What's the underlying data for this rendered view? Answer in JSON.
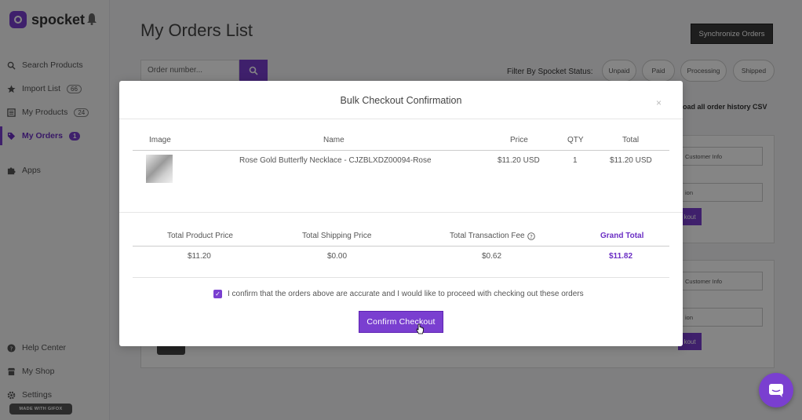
{
  "app": {
    "logo_text": "spocket"
  },
  "sidebar": {
    "items": [
      {
        "label": "Search Products",
        "icon": "search-icon"
      },
      {
        "label": "Import List",
        "badge": "66",
        "icon": "star-icon"
      },
      {
        "label": "My Products",
        "badge": "24",
        "icon": "list-icon"
      },
      {
        "label": "My Orders",
        "badge": "1",
        "icon": "tag-icon",
        "active": true
      },
      {
        "label": "Apps",
        "icon": "puzzle-icon"
      }
    ],
    "bottom_items": [
      {
        "label": "Help Center",
        "icon": "help-icon"
      },
      {
        "label": "My Shop",
        "icon": "shop-icon"
      },
      {
        "label": "Settings",
        "icon": "gear-icon"
      }
    ],
    "watermark": "MADE WITH GIFOX"
  },
  "main": {
    "title": "My Orders List",
    "sync_button": "Synchronize Orders",
    "search_placeholder": "Order number...",
    "filter_label": "Filter By Spocket Status:",
    "filters": [
      "Unpaid",
      "Paid",
      "Processing",
      "Shipped"
    ],
    "download_link": "nload all order history CSV",
    "card_customer_info": "Customer Info",
    "card_option": "ion",
    "card_checkout": "kout"
  },
  "modal": {
    "title": "Bulk Checkout Confirmation",
    "close": "×",
    "table_headers": {
      "image": "Image",
      "name": "Name",
      "price": "Price",
      "qty": "QTY",
      "total": "Total"
    },
    "item": {
      "name": "Rose Gold Butterfly Necklace - CJZBLXDZ00094-Rose",
      "price": "$11.20 USD",
      "qty": "1",
      "total": "$11.20 USD"
    },
    "summary_headers": {
      "product": "Total Product Price",
      "shipping": "Total Shipping Price",
      "fee": "Total Transaction Fee",
      "grand": "Grand Total"
    },
    "summary_values": {
      "product": "$11.20",
      "shipping": "$0.00",
      "fee": "$0.62",
      "grand": "$11.82"
    },
    "confirm_text": "I confirm that the orders above are accurate and I would like to proceed with checking out these orders",
    "confirm_checked": true,
    "confirm_button": "Confirm Checkout"
  },
  "colors": {
    "accent": "#7a3fd0"
  }
}
